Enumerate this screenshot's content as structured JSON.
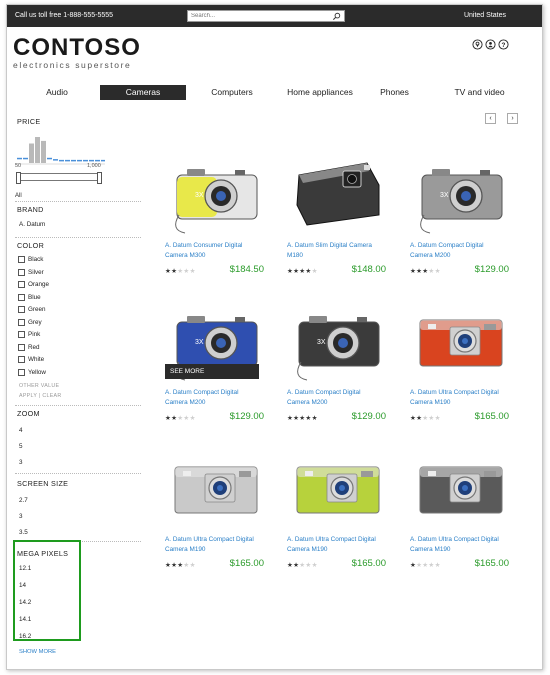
{
  "topbar": {
    "phone": "Call us toll free 1-888-555-5555",
    "search_placeholder": "Search...",
    "country": "United States"
  },
  "logo": {
    "name": "CONTOSO",
    "tagline": "electronics superstore"
  },
  "header_icons": [
    "location-icon",
    "user-icon",
    "help-icon"
  ],
  "nav": {
    "items": [
      {
        "label": "Audio",
        "active": false
      },
      {
        "label": "Cameras",
        "active": true
      },
      {
        "label": "Computers",
        "active": false
      },
      {
        "label": "Home appliances",
        "active": false
      },
      {
        "label": "Phones",
        "active": false
      },
      {
        "label": "TV and video",
        "active": false
      }
    ]
  },
  "pager": {
    "prev": "‹",
    "next": "›"
  },
  "filters": {
    "price": {
      "title": "PRICE",
      "min_label": "50",
      "max_label": "1,000",
      "all_label": "All",
      "histogram": [
        0.2,
        0.2,
        0.75,
        1.0,
        0.85,
        0.2,
        0.15,
        0.12,
        0.12,
        0.12,
        0.12,
        0.12,
        0.12,
        0.12,
        0.12
      ]
    },
    "brand": {
      "title": "BRAND",
      "options": [
        "A. Datum"
      ]
    },
    "color": {
      "title": "COLOR",
      "options": [
        "Black",
        "Silver",
        "Orange",
        "Blue",
        "Green",
        "Grey",
        "Pink",
        "Red",
        "White",
        "Yellow"
      ],
      "other_value": "OTHER VALUE",
      "apply": "APPLY",
      "clear": "CLEAR"
    },
    "zoom": {
      "title": "ZOOM",
      "options": [
        "4",
        "5",
        "3"
      ]
    },
    "screen_size": {
      "title": "SCREEN SIZE",
      "options": [
        "2.7",
        "3",
        "3.5"
      ]
    },
    "mega_pixels": {
      "title": "MEGA PIXELS",
      "options": [
        "12.1",
        "14",
        "14.2",
        "14.1",
        "16.2"
      ]
    },
    "show_more": "SHOW MORE"
  },
  "see_more": "SEE MORE",
  "colors": {
    "accent_green": "#2b9b2b",
    "link_blue": "#2a7fc7",
    "dark": "#2b2b2b",
    "highlight_green": "#1e9b1e"
  },
  "products": [
    {
      "name": "A. Datum Consumer Digital Camera M300",
      "price": "$184.50",
      "rating": 2,
      "body": "#e8e84a",
      "style": "compact-yellow"
    },
    {
      "name": "A. Datum Slim Digital Camera M180",
      "price": "$148.00",
      "rating": 4,
      "body": "#3a3a3a",
      "style": "slim-black"
    },
    {
      "name": "A. Datum Compact Digital Camera M200",
      "price": "$129.00",
      "rating": 3,
      "body": "#9a9a9a",
      "style": "compact-grey"
    },
    {
      "name": "A. Datum Compact Digital Camera M200",
      "price": "$129.00",
      "rating": 2,
      "body": "#2f4fb0",
      "style": "compact-blue"
    },
    {
      "name": "A. Datum Compact Digital Camera M200",
      "price": "$129.00",
      "rating": 5,
      "body": "#3b3b3b",
      "style": "compact-black"
    },
    {
      "name": "A. Datum Ultra Compact Digital Camera M190",
      "price": "$165.00",
      "rating": 2,
      "body": "#d9441f",
      "style": "ultra-red"
    },
    {
      "name": "A. Datum Ultra Compact Digital Camera M190",
      "price": "$165.00",
      "rating": 3,
      "body": "#c9c9c9",
      "style": "ultra-silver"
    },
    {
      "name": "A. Datum Ultra Compact Digital Camera M190",
      "price": "$165.00",
      "rating": 2,
      "body": "#b7d23c",
      "style": "ultra-green"
    },
    {
      "name": "A. Datum Ultra Compact Digital Camera M190",
      "price": "$165.00",
      "rating": 1,
      "body": "#5a5a5a",
      "style": "ultra-black"
    }
  ]
}
